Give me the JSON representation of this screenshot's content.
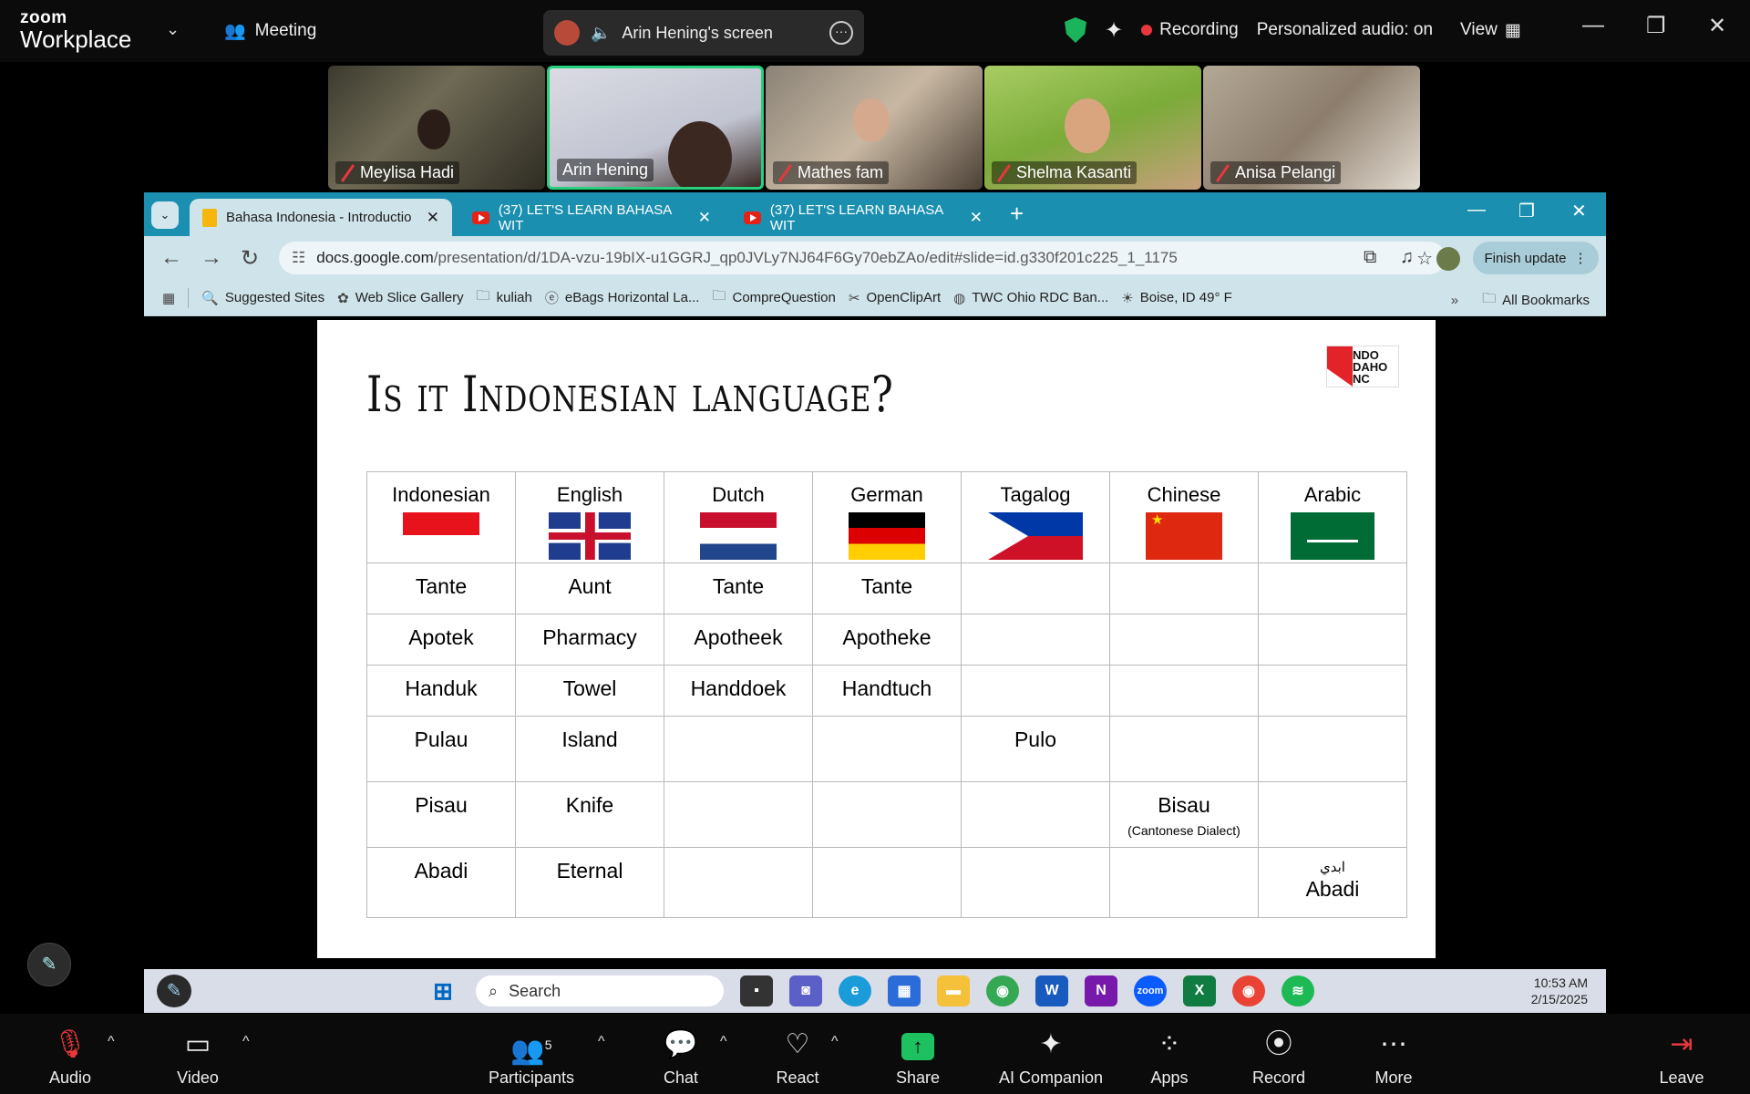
{
  "zoom": {
    "brand_small": "zoom",
    "brand_large": "Workplace",
    "meeting_label": "Meeting",
    "share_label": "Arin Hening's screen",
    "recording_label": "Recording",
    "audio_label": "Personalized audio: on",
    "view_label": "View",
    "participants": [
      {
        "name": "Meylisa Hadi",
        "muted": true
      },
      {
        "name": "Arin Hening",
        "muted": false,
        "active": true
      },
      {
        "name": "Mathes fam",
        "muted": true
      },
      {
        "name": "Shelma Kasanti",
        "muted": true
      },
      {
        "name": "Anisa Pelangi",
        "muted": true
      }
    ],
    "bottom": {
      "audio": "Audio",
      "video": "Video",
      "participants": "Participants",
      "participants_count": "5",
      "chat": "Chat",
      "react": "React",
      "share": "Share",
      "ai": "AI Companion",
      "apps": "Apps",
      "record": "Record",
      "more": "More",
      "leave": "Leave"
    }
  },
  "browser": {
    "tabs": [
      {
        "label": "Bahasa Indonesia - Introductio",
        "active": true
      },
      {
        "label": "(37) LET'S LEARN BAHASA WIT",
        "active": false
      },
      {
        "label": "(37) LET'S LEARN BAHASA WIT",
        "active": false
      }
    ],
    "url_host": "docs.google.com",
    "url_path": "/presentation/d/1DA-vzu-19bIX-u1GGRJ_qp0JVLy7NJ64F6Gy70ebZAo/edit#slide=id.g330f201c225_1_1175",
    "finish_update": "Finish update",
    "bookmarks": [
      "Suggested Sites",
      "Web Slice Gallery",
      "kuliah",
      "eBags Horizontal La...",
      "CompreQuestion",
      "OpenClipArt",
      "TWC Ohio RDC Ban...",
      "Boise, ID 49° F"
    ],
    "all_bookmarks": "All Bookmarks"
  },
  "slide": {
    "title": "Is it Indonesian language?",
    "logo_text": [
      "NDO",
      "DAHO",
      "NC"
    ],
    "headers": [
      "Indonesian",
      "English",
      "Dutch",
      "German",
      "Tagalog",
      "Chinese",
      "Arabic"
    ],
    "rows": [
      [
        "Tante",
        "Aunt",
        "Tante",
        "Tante",
        "",
        "",
        ""
      ],
      [
        "Apotek",
        "Pharmacy",
        "Apotheek",
        "Apotheke",
        "",
        "",
        ""
      ],
      [
        "Handuk",
        "Towel",
        "Handdoek",
        "Handtuch",
        "",
        "",
        ""
      ],
      [
        "Pulau",
        "Island",
        "",
        "",
        "Pulo",
        "",
        ""
      ],
      [
        "Pisau",
        "Knife",
        "",
        "",
        "",
        "Bisau",
        ""
      ],
      [
        "Abadi",
        "Eternal",
        "",
        "",
        "",
        "",
        "Abadi"
      ]
    ],
    "chinese_note": "(Cantonese Dialect)",
    "arabic_script": "ابدي"
  },
  "taskbar": {
    "search": "Search",
    "time": "10:53 AM",
    "date": "2/15/2025"
  }
}
